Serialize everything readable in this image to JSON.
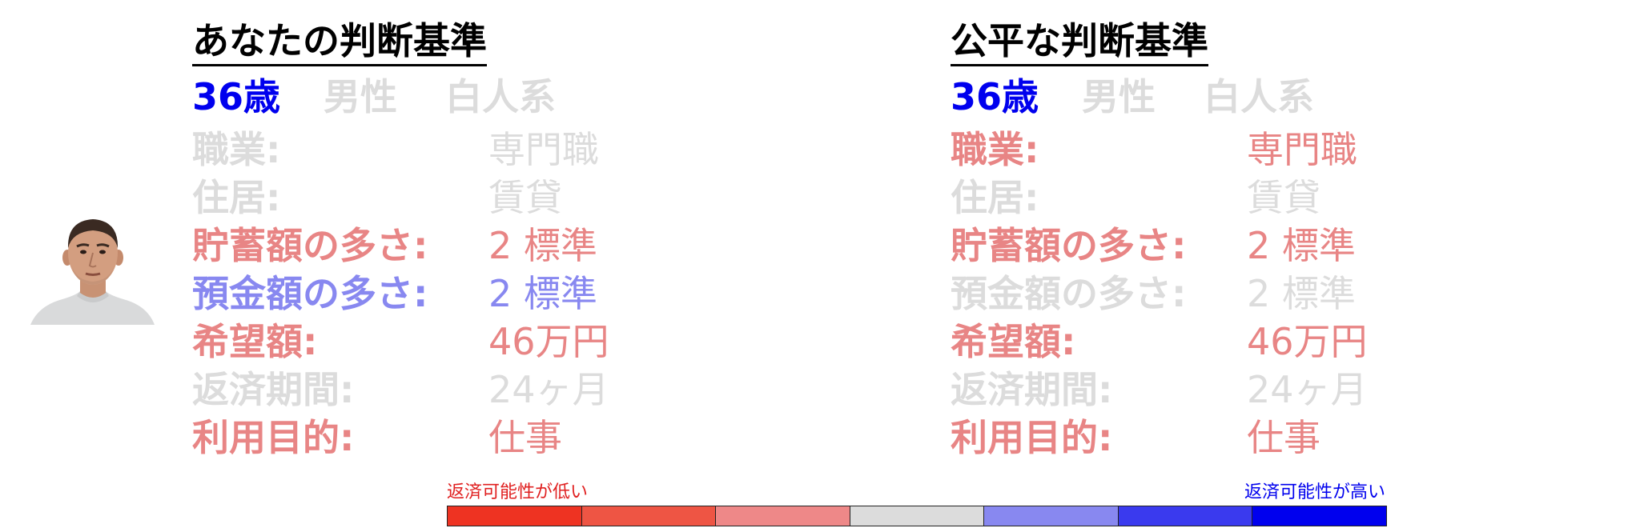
{
  "colors": {
    "dim": "#dcdcdc",
    "red": "#e88585",
    "blue": "#8888f0",
    "age": "#0000ee",
    "low_text": "#e02020",
    "high_text": "#0000ee"
  },
  "panels": [
    {
      "title": "あなたの判断基準",
      "demographics": {
        "age": {
          "text": "36歳",
          "state": "age"
        },
        "gender": {
          "text": "男性",
          "state": "dim"
        },
        "race": {
          "text": "白人系",
          "state": "dim"
        }
      },
      "rows": [
        {
          "label": "職業:",
          "value": "専門職",
          "state": "dim"
        },
        {
          "label": "住居:",
          "value": "賃貸",
          "state": "dim"
        },
        {
          "label": "貯蓄額の多さ:",
          "value": "2 標準",
          "state": "red"
        },
        {
          "label": "預金額の多さ:",
          "value": "2 標準",
          "state": "blue"
        },
        {
          "label": "希望額:",
          "value": "46万円",
          "state": "red"
        },
        {
          "label": "返済期間:",
          "value": "24ヶ月",
          "state": "dim"
        },
        {
          "label": "利用目的:",
          "value": "仕事",
          "state": "red"
        }
      ]
    },
    {
      "title": "公平な判断基準",
      "demographics": {
        "age": {
          "text": "36歳",
          "state": "age"
        },
        "gender": {
          "text": "男性",
          "state": "dim"
        },
        "race": {
          "text": "白人系",
          "state": "dim"
        }
      },
      "rows": [
        {
          "label": "職業:",
          "value": "専門職",
          "state": "red"
        },
        {
          "label": "住居:",
          "value": "賃貸",
          "state": "dim"
        },
        {
          "label": "貯蓄額の多さ:",
          "value": "2 標準",
          "state": "red"
        },
        {
          "label": "預金額の多さ:",
          "value": "2 標準",
          "state": "dim"
        },
        {
          "label": "希望額:",
          "value": "46万円",
          "state": "red"
        },
        {
          "label": "返済期間:",
          "value": "24ヶ月",
          "state": "dim"
        },
        {
          "label": "利用目的:",
          "value": "仕事",
          "state": "red"
        }
      ]
    }
  ],
  "scale": {
    "low_label": "返済可能性が低い",
    "high_label": "返済可能性が高い",
    "segments": [
      "#ee3322",
      "#ee5544",
      "#ee8888",
      "#dcdcdc",
      "#8888f0",
      "#3a3aee",
      "#0000ee"
    ]
  }
}
